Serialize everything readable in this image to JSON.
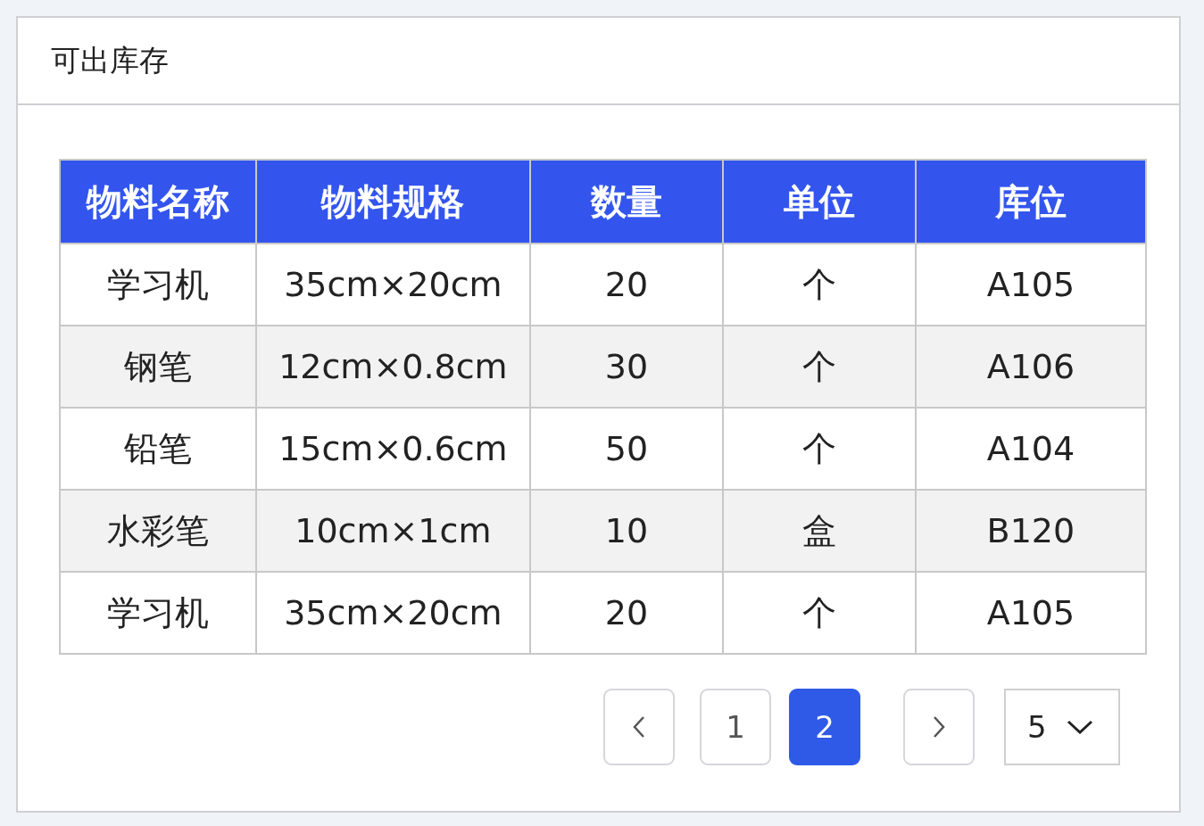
{
  "panel": {
    "title": "可出库存"
  },
  "table": {
    "columns": [
      "物料名称",
      "物料规格",
      "数量",
      "单位",
      "库位"
    ],
    "rows": [
      [
        "学习机",
        "35cm×20cm",
        "20",
        "个",
        "A105"
      ],
      [
        "钢笔",
        "12cm×0.8cm",
        "30",
        "个",
        "A106"
      ],
      [
        "铅笔",
        "15cm×0.6cm",
        "50",
        "个",
        "A104"
      ],
      [
        "水彩笔",
        "10cm×1cm",
        "10",
        "盒",
        "B120"
      ],
      [
        "学习机",
        "35cm×20cm",
        "20",
        "个",
        "A105"
      ]
    ]
  },
  "pagination": {
    "pages": [
      {
        "label": "1",
        "selected": false
      },
      {
        "label": "2",
        "selected": true
      }
    ],
    "page_size": "5"
  }
}
